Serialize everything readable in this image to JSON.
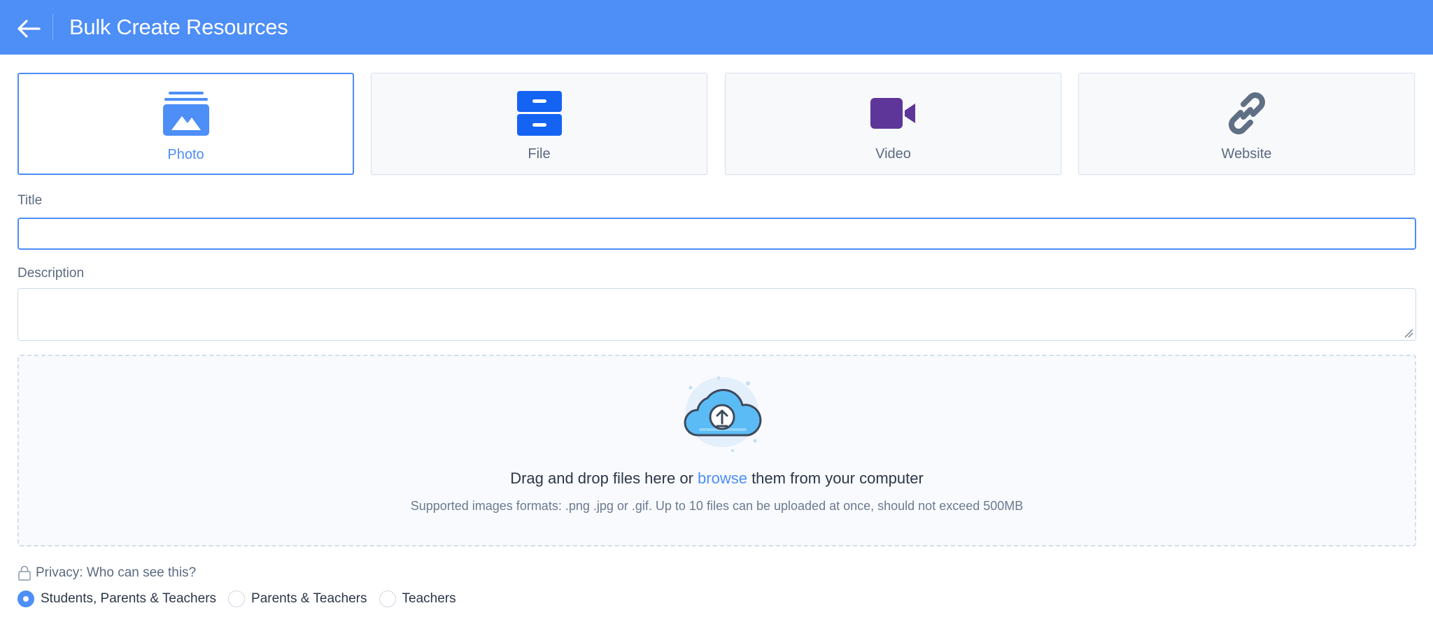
{
  "header": {
    "title": "Bulk Create Resources",
    "back_icon": "arrow-left-icon"
  },
  "resource_types": [
    {
      "label": "Photo",
      "icon": "photo-icon",
      "selected": true,
      "color": "#4d8ef7"
    },
    {
      "label": "File",
      "icon": "file-cabinet-icon",
      "selected": false,
      "color": "#1463f3"
    },
    {
      "label": "Video",
      "icon": "video-camera-icon",
      "selected": false,
      "color": "#5e3598"
    },
    {
      "label": "Website",
      "icon": "link-icon",
      "selected": false,
      "color": "#5f6f84"
    }
  ],
  "form": {
    "title_label": "Title",
    "title_value": "",
    "description_label": "Description",
    "description_value": ""
  },
  "dropzone": {
    "icon": "cloud-upload-icon",
    "text_before": "Drag and drop files here or",
    "link_text": "browse",
    "text_after": "them from your computer",
    "supported": "Supported images formats: .png .jpg or .gif. Up to 10 files can be uploaded at once, should not exceed 500MB"
  },
  "privacy": {
    "label": "Privacy: Who can see this?",
    "icon": "lock-icon",
    "options": [
      {
        "label": "Students, Parents & Teachers",
        "checked": true
      },
      {
        "label": "Parents & Teachers",
        "checked": false
      },
      {
        "label": "Teachers",
        "checked": false
      }
    ]
  },
  "colors": {
    "accent": "#4d8ef7",
    "header_bg": "#4d8ef7"
  }
}
